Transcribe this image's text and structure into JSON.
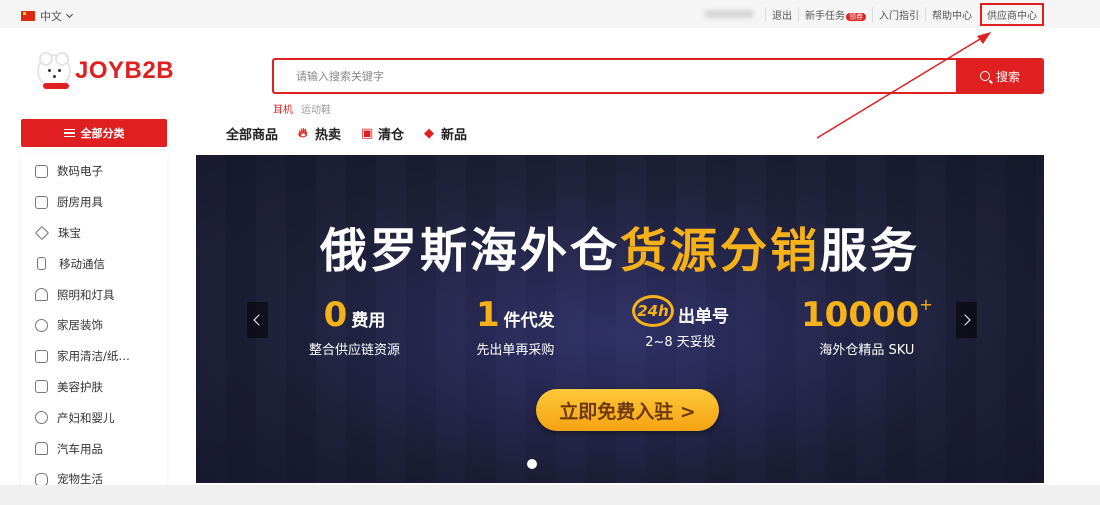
{
  "topbar": {
    "language": "中文",
    "links": {
      "logout": "退出",
      "new_tasks": "新手任务",
      "new_badge": "领券",
      "getting_started": "入门指引",
      "help_center": "帮助中心",
      "supplier_center": "供应商中心"
    }
  },
  "logo": {
    "text": "JOYB2B"
  },
  "search": {
    "placeholder": "请输入搜索关键字",
    "button": "搜索",
    "hot_words": [
      "耳机",
      "运动鞋"
    ]
  },
  "all_categories_button": "全部分类",
  "nav": {
    "all_products": "全部商品",
    "hot_sale": "热卖",
    "clearance": "清仓",
    "new_arrivals": "新品"
  },
  "categories": [
    "数码电子",
    "厨房用具",
    "珠宝",
    "移动通信",
    "照明和灯具",
    "家居装饰",
    "家用清洁/纸…",
    "美容护肤",
    "产妇和婴儿",
    "汽车用品",
    "宠物生活"
  ],
  "banner": {
    "title_prefix": "俄罗斯海外仓",
    "title_highlight": "货源分销",
    "title_suffix": "服务",
    "features": [
      {
        "big": "0",
        "unit": "费用",
        "sub": "整合供应链资源"
      },
      {
        "big": "1",
        "unit": "件代发",
        "sub": "先出单再采购"
      },
      {
        "big": "24h",
        "unit": "出单号",
        "sub": "2~8 天妥投"
      },
      {
        "big": "10000",
        "unit": "+",
        "sub": "海外仓精品 SKU"
      }
    ],
    "cta": "立即免费入驻 >"
  },
  "colors": {
    "brand_red": "#e02020",
    "banner_gold": "#f7b21a",
    "banner_bg": "#1e2036"
  }
}
